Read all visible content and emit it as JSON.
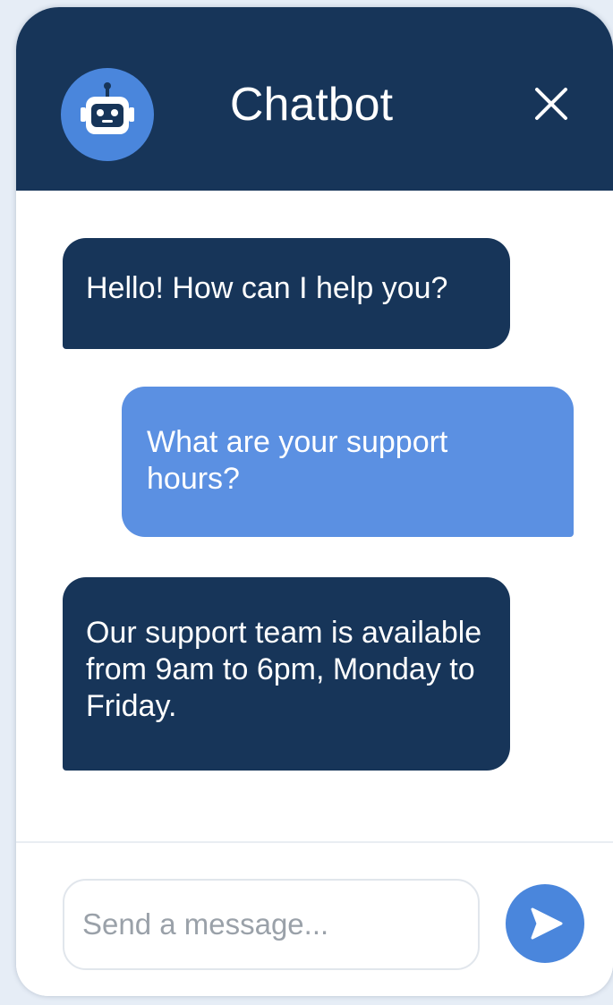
{
  "header": {
    "title": "Chatbot",
    "avatar_icon": "robot-icon",
    "close_icon": "close-icon"
  },
  "messages": [
    {
      "sender": "bot",
      "text": "Hello! How can I help you?"
    },
    {
      "sender": "user",
      "text": "What are your support hours?"
    },
    {
      "sender": "bot",
      "text": "Our support team is available from 9am to 6pm, Monday to Friday."
    }
  ],
  "composer": {
    "placeholder": "Send a message...",
    "value": "",
    "send_icon": "send-arrow-icon"
  },
  "colors": {
    "header_bg": "#173559",
    "bot_bubble": "#173559",
    "user_bubble": "#5b90e2",
    "accent": "#4a86dc",
    "page_bg": "#e6edf6"
  }
}
